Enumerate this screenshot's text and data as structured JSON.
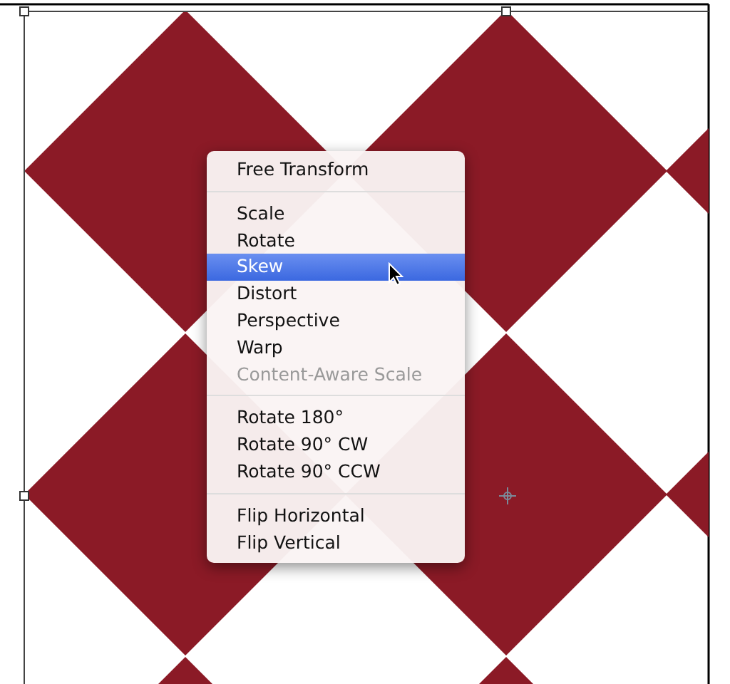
{
  "context_menu": {
    "groups": [
      {
        "items": [
          {
            "label": "Free Transform",
            "selected": false,
            "disabled": false
          }
        ]
      },
      {
        "items": [
          {
            "label": "Scale",
            "selected": false,
            "disabled": false
          },
          {
            "label": "Rotate",
            "selected": false,
            "disabled": false
          },
          {
            "label": "Skew",
            "selected": true,
            "disabled": false
          },
          {
            "label": "Distort",
            "selected": false,
            "disabled": false
          },
          {
            "label": "Perspective",
            "selected": false,
            "disabled": false
          },
          {
            "label": "Warp",
            "selected": false,
            "disabled": false
          },
          {
            "label": "Content-Aware Scale",
            "selected": false,
            "disabled": true
          }
        ]
      },
      {
        "items": [
          {
            "label": "Rotate 180°",
            "selected": false,
            "disabled": false
          },
          {
            "label": "Rotate 90° CW",
            "selected": false,
            "disabled": false
          },
          {
            "label": "Rotate 90° CCW",
            "selected": false,
            "disabled": false
          }
        ]
      },
      {
        "items": [
          {
            "label": "Flip Horizontal",
            "selected": false,
            "disabled": false
          },
          {
            "label": "Flip Vertical",
            "selected": false,
            "disabled": false
          }
        ]
      }
    ]
  }
}
